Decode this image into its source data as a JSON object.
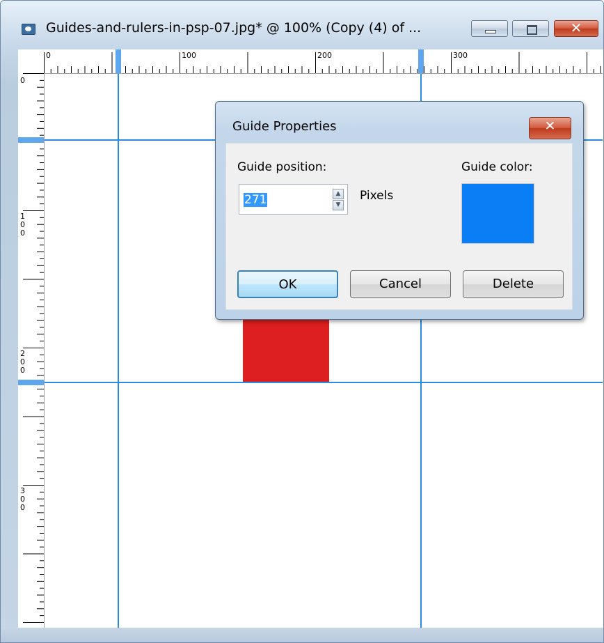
{
  "window": {
    "title": "Guides-and-rulers-in-psp-07.jpg* @ 100% (Copy (4) of ...",
    "minimize_glyph": "",
    "close_glyph": "✕"
  },
  "rulers": {
    "top_labels": [
      "0",
      "100",
      "200",
      "300"
    ],
    "left_labels": [
      "0",
      "100",
      "200",
      "300"
    ]
  },
  "dialog": {
    "title": "Guide Properties",
    "close_glyph": "✕",
    "position_label": "Guide position:",
    "position_value": "271",
    "unit_label": "Pixels",
    "color_label": "Guide color:",
    "color_value": "#0a7ff5",
    "ok_label": "OK",
    "cancel_label": "Cancel",
    "delete_label": "Delete",
    "spin_up_glyph": "▲",
    "spin_down_glyph": "▼"
  },
  "colors": {
    "guide": "#2a8ce0",
    "red_shape": "#dd1f1f"
  }
}
